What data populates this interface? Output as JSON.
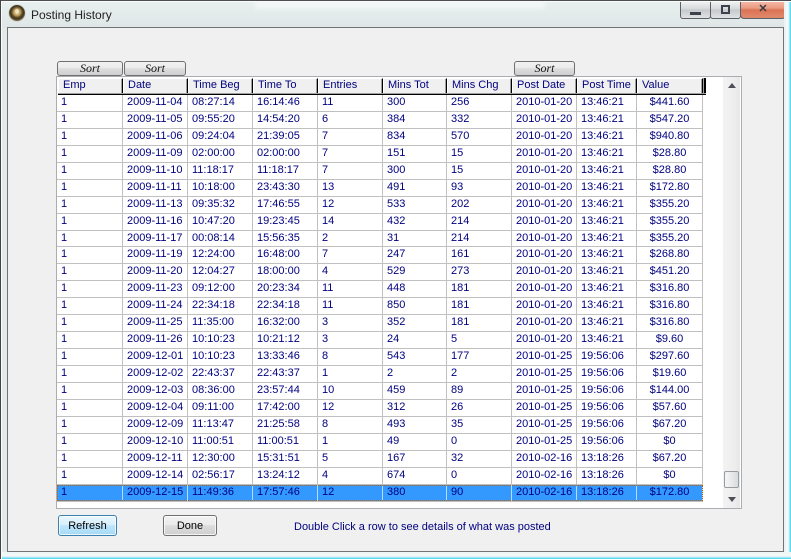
{
  "window": {
    "title": "Posting History"
  },
  "window_controls": {
    "minimize": "minimize",
    "maximize": "maximize",
    "close": "close"
  },
  "sort_buttons": [
    {
      "label": "Sort"
    },
    {
      "label": "Sort"
    },
    {
      "label": "Sort"
    }
  ],
  "table": {
    "columns": [
      "Emp",
      "Date",
      "Time Beg",
      "Time To",
      "Entries",
      "Mins Tot",
      "Mins Chg",
      "Post Date",
      "Post Time",
      "Value"
    ],
    "rows": [
      [
        "1",
        "2009-11-04",
        "08:27:14",
        "16:14:46",
        "11",
        "300",
        "256",
        "2010-01-20",
        "13:46:21",
        "$441.60"
      ],
      [
        "1",
        "2009-11-05",
        "09:55:20",
        "14:54:20",
        "6",
        "384",
        "332",
        "2010-01-20",
        "13:46:21",
        "$547.20"
      ],
      [
        "1",
        "2009-11-06",
        "09:24:04",
        "21:39:05",
        "7",
        "834",
        "570",
        "2010-01-20",
        "13:46:21",
        "$940.80"
      ],
      [
        "1",
        "2009-11-09",
        "02:00:00",
        "02:00:00",
        "7",
        "151",
        "15",
        "2010-01-20",
        "13:46:21",
        "$28.80"
      ],
      [
        "1",
        "2009-11-10",
        "11:18:17",
        "11:18:17",
        "7",
        "300",
        "15",
        "2010-01-20",
        "13:46:21",
        "$28.80"
      ],
      [
        "1",
        "2009-11-11",
        "10:18:00",
        "23:43:30",
        "13",
        "491",
        "93",
        "2010-01-20",
        "13:46:21",
        "$172.80"
      ],
      [
        "1",
        "2009-11-13",
        "09:35:32",
        "17:46:55",
        "12",
        "533",
        "202",
        "2010-01-20",
        "13:46:21",
        "$355.20"
      ],
      [
        "1",
        "2009-11-16",
        "10:47:20",
        "19:23:45",
        "14",
        "432",
        "214",
        "2010-01-20",
        "13:46:21",
        "$355.20"
      ],
      [
        "1",
        "2009-11-17",
        "00:08:14",
        "15:56:35",
        "2",
        "31",
        "214",
        "2010-01-20",
        "13:46:21",
        "$355.20"
      ],
      [
        "1",
        "2009-11-19",
        "12:24:00",
        "16:48:00",
        "7",
        "247",
        "161",
        "2010-01-20",
        "13:46:21",
        "$268.80"
      ],
      [
        "1",
        "2009-11-20",
        "12:04:27",
        "18:00:00",
        "4",
        "529",
        "273",
        "2010-01-20",
        "13:46:21",
        "$451.20"
      ],
      [
        "1",
        "2009-11-23",
        "09:12:00",
        "20:23:34",
        "11",
        "448",
        "181",
        "2010-01-20",
        "13:46:21",
        "$316.80"
      ],
      [
        "1",
        "2009-11-24",
        "22:34:18",
        "22:34:18",
        "11",
        "850",
        "181",
        "2010-01-20",
        "13:46:21",
        "$316.80"
      ],
      [
        "1",
        "2009-11-25",
        "11:35:00",
        "16:32:00",
        "3",
        "352",
        "181",
        "2010-01-20",
        "13:46:21",
        "$316.80"
      ],
      [
        "1",
        "2009-11-26",
        "10:10:23",
        "10:21:12",
        "3",
        "24",
        "5",
        "2010-01-20",
        "13:46:21",
        "$9.60"
      ],
      [
        "1",
        "2009-12-01",
        "10:10:23",
        "13:33:46",
        "8",
        "543",
        "177",
        "2010-01-25",
        "19:56:06",
        "$297.60"
      ],
      [
        "1",
        "2009-12-02",
        "22:43:37",
        "22:43:37",
        "1",
        "2",
        "2",
        "2010-01-25",
        "19:56:06",
        "$19.60"
      ],
      [
        "1",
        "2009-12-03",
        "08:36:00",
        "23:57:44",
        "10",
        "459",
        "89",
        "2010-01-25",
        "19:56:06",
        "$144.00"
      ],
      [
        "1",
        "2009-12-04",
        "09:11:00",
        "17:42:00",
        "12",
        "312",
        "26",
        "2010-01-25",
        "19:56:06",
        "$57.60"
      ],
      [
        "1",
        "2009-12-09",
        "11:13:47",
        "21:25:58",
        "8",
        "493",
        "35",
        "2010-01-25",
        "19:56:06",
        "$67.20"
      ],
      [
        "1",
        "2009-12-10",
        "11:00:51",
        "11:00:51",
        "1",
        "49",
        "0",
        "2010-01-25",
        "19:56:06",
        "$0"
      ],
      [
        "1",
        "2009-12-11",
        "12:30:00",
        "15:31:51",
        "5",
        "167",
        "32",
        "2010-02-16",
        "13:18:26",
        "$67.20"
      ],
      [
        "1",
        "2009-12-14",
        "02:56:17",
        "13:24:12",
        "4",
        "674",
        "0",
        "2010-02-16",
        "13:18:26",
        "$0"
      ],
      [
        "1",
        "2009-12-15",
        "11:49:36",
        "17:57:46",
        "12",
        "380",
        "90",
        "2010-02-16",
        "13:18:26",
        "$172.80"
      ]
    ],
    "selected_row_index": 23
  },
  "footer": {
    "refresh_label": "Refresh",
    "done_label": "Done",
    "hint": "Double Click a row to see details of what was posted"
  },
  "colors": {
    "selection_blue": "#3399ff",
    "text_navy": "#000080"
  }
}
